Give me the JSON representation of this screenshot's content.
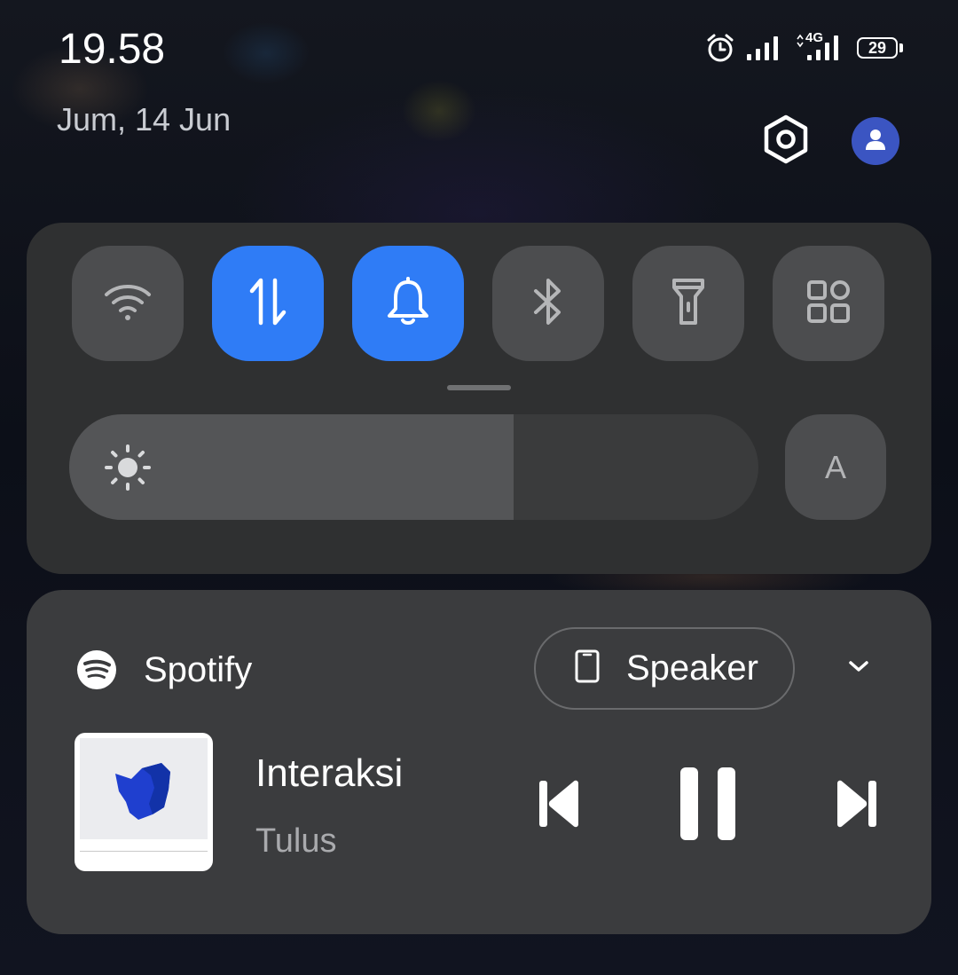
{
  "status_bar": {
    "time": "19.58",
    "network_label": "4G",
    "battery_level": "29",
    "icons": [
      "alarm-icon",
      "signal-icon",
      "signal-4g-icon",
      "battery-icon"
    ]
  },
  "header": {
    "date": "Jum, 14 Jun",
    "icons": [
      "settings-icon",
      "profile-icon"
    ]
  },
  "quick_settings": {
    "tiles": [
      {
        "name": "wifi",
        "icon": "wifi-icon",
        "active": false
      },
      {
        "name": "mobile-data",
        "icon": "data-transfer-icon",
        "active": true
      },
      {
        "name": "sound",
        "icon": "bell-icon",
        "active": true
      },
      {
        "name": "bluetooth",
        "icon": "bluetooth-icon",
        "active": false
      },
      {
        "name": "flashlight",
        "icon": "flashlight-icon",
        "active": false
      },
      {
        "name": "more",
        "icon": "grid-icon",
        "active": false
      }
    ],
    "brightness": {
      "level_fraction": 0.645,
      "icon": "sun-icon"
    },
    "auto_brightness_label": "A",
    "colors": {
      "active_tile": "#2f7cf6",
      "inactive_tile": "#4c4d4f"
    }
  },
  "media": {
    "app_name": "Spotify",
    "output_device": "Speaker",
    "track_title": "Interaksi",
    "artist": "Tulus",
    "icons": [
      "spotify-icon",
      "phone-icon",
      "chevron-down-icon",
      "previous-icon",
      "pause-icon",
      "next-icon"
    ]
  }
}
